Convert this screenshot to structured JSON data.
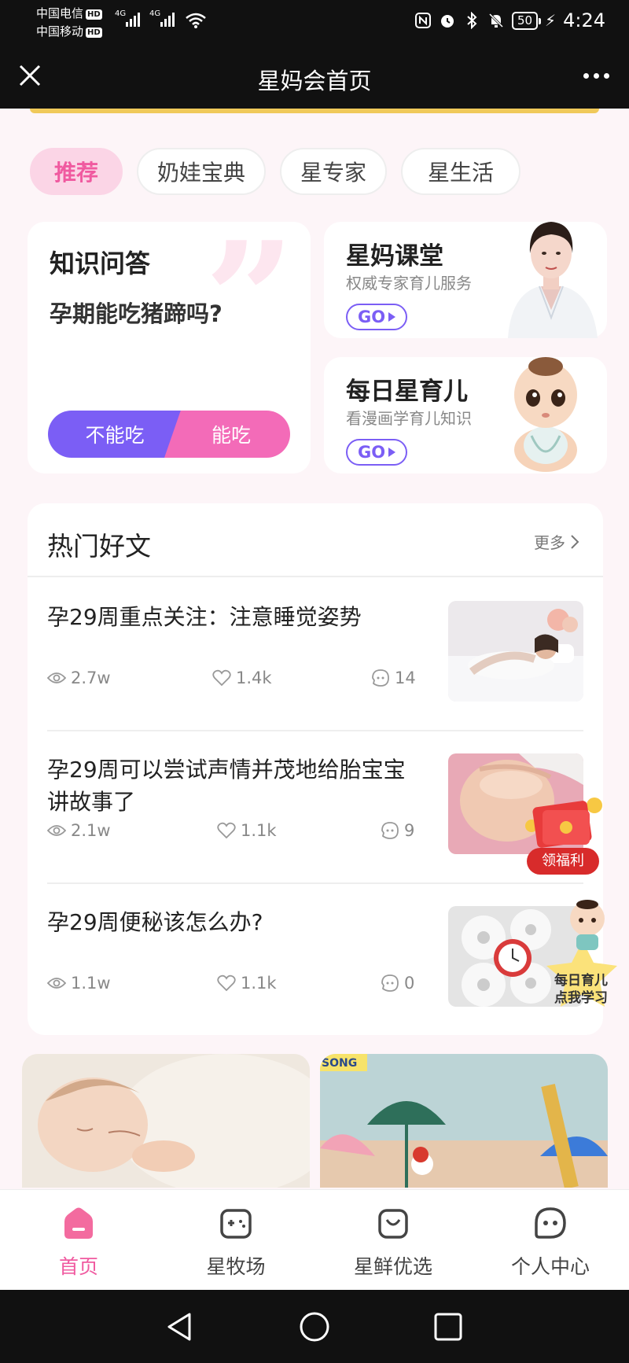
{
  "status_bar": {
    "carrier1": "中国电信",
    "carrier2": "中国移动",
    "hd_label": "HD",
    "network1": "4G",
    "network2": "4G",
    "battery": "50",
    "time": "4:24",
    "icons": [
      "nfc-icon",
      "alarm-icon",
      "bluetooth-icon",
      "mute-icon",
      "battery-icon",
      "charging-icon"
    ]
  },
  "title_bar": {
    "title": "星妈会首页"
  },
  "tabs": [
    {
      "label": "推荐",
      "active": true
    },
    {
      "label": "奶娃宝典",
      "active": false
    },
    {
      "label": "星专家",
      "active": false
    },
    {
      "label": "星生活",
      "active": false
    }
  ],
  "qa": {
    "label": "知识问答",
    "question": "孕期能吃猪蹄吗?",
    "answer_no": "不能吃",
    "answer_yes": "能吃"
  },
  "side_cards": [
    {
      "title": "星妈课堂",
      "subtitle": "权威专家育儿服务",
      "go": "GO"
    },
    {
      "title": "每日星育儿",
      "subtitle": "看漫画学育儿知识",
      "go": "GO"
    }
  ],
  "hot_articles": {
    "title": "热门好文",
    "more": "更多",
    "items": [
      {
        "title": "孕29周重点关注：注意睡觉姿势",
        "views": "2.7w",
        "likes": "1.4k",
        "comments": "14"
      },
      {
        "title": "孕29周可以尝试声情并茂地给胎宝宝讲故事了",
        "views": "2.1w",
        "likes": "1.1k",
        "comments": "9"
      },
      {
        "title": "孕29周便秘该怎么办?",
        "views": "1.1w",
        "likes": "1.1k",
        "comments": "0"
      }
    ]
  },
  "widgets": {
    "welfare": "领福利",
    "daily_study_line1": "每日育儿",
    "daily_study_line2": "点我学习"
  },
  "promo": {
    "song_label": "SONG"
  },
  "bottom_nav": [
    {
      "label": "首页",
      "icon": "home-icon",
      "active": true
    },
    {
      "label": "星牧场",
      "icon": "game-icon",
      "active": false
    },
    {
      "label": "星鲜优选",
      "icon": "shopping-bag-icon",
      "active": false
    },
    {
      "label": "个人中心",
      "icon": "profile-face-icon",
      "active": false
    }
  ],
  "colors": {
    "accent_pink": "#f05aa0",
    "accent_purple": "#7b5ef5",
    "background": "#fdf5f8"
  }
}
